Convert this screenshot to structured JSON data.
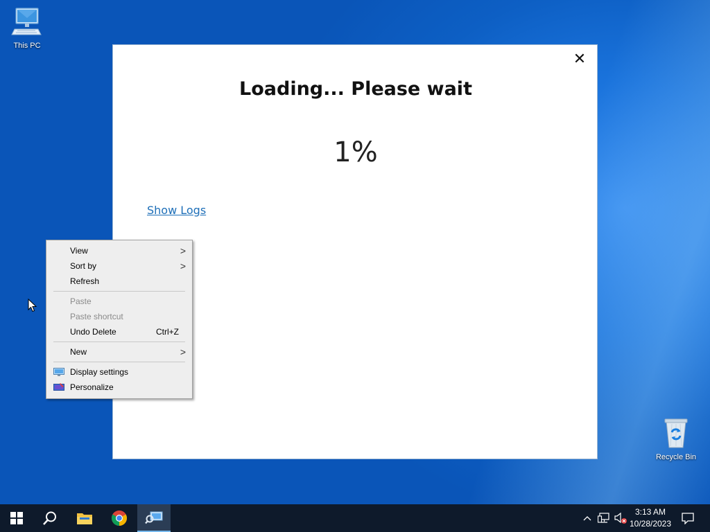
{
  "desktop": {
    "icons": [
      {
        "label": "This PC"
      },
      {
        "label": "Recycle Bin"
      }
    ]
  },
  "dialog": {
    "close_glyph": "✕",
    "title": "Loading... Please wait",
    "progress_text": "1%",
    "progress_value": 1,
    "show_logs_label": "Show Logs"
  },
  "context_menu": {
    "items": [
      {
        "label": "View",
        "submenu": true,
        "enabled": true
      },
      {
        "label": "Sort by",
        "submenu": true,
        "enabled": true
      },
      {
        "label": "Refresh",
        "enabled": true
      },
      {
        "label": "Paste",
        "enabled": false
      },
      {
        "label": "Paste shortcut",
        "enabled": false
      },
      {
        "label": "Undo Delete",
        "shortcut": "Ctrl+Z",
        "enabled": true
      },
      {
        "label": "New",
        "submenu": true,
        "enabled": true
      },
      {
        "label": "Display settings",
        "icon": "display-settings-icon",
        "enabled": true
      },
      {
        "label": "Personalize",
        "icon": "personalize-icon",
        "enabled": true
      }
    ],
    "submenu_glyph": ">"
  },
  "taskbar": {
    "buttons": [
      "start-icon",
      "search-icon",
      "file-explorer-icon",
      "chrome-icon",
      "app-window-icon"
    ],
    "tray": [
      "show-hidden-icons-chevron",
      "network-icon",
      "volume-muted-icon",
      "notification-icon"
    ],
    "clock": {
      "time": "3:13 AM",
      "date": "10/28/2023"
    },
    "accent": "#76b9ed"
  }
}
